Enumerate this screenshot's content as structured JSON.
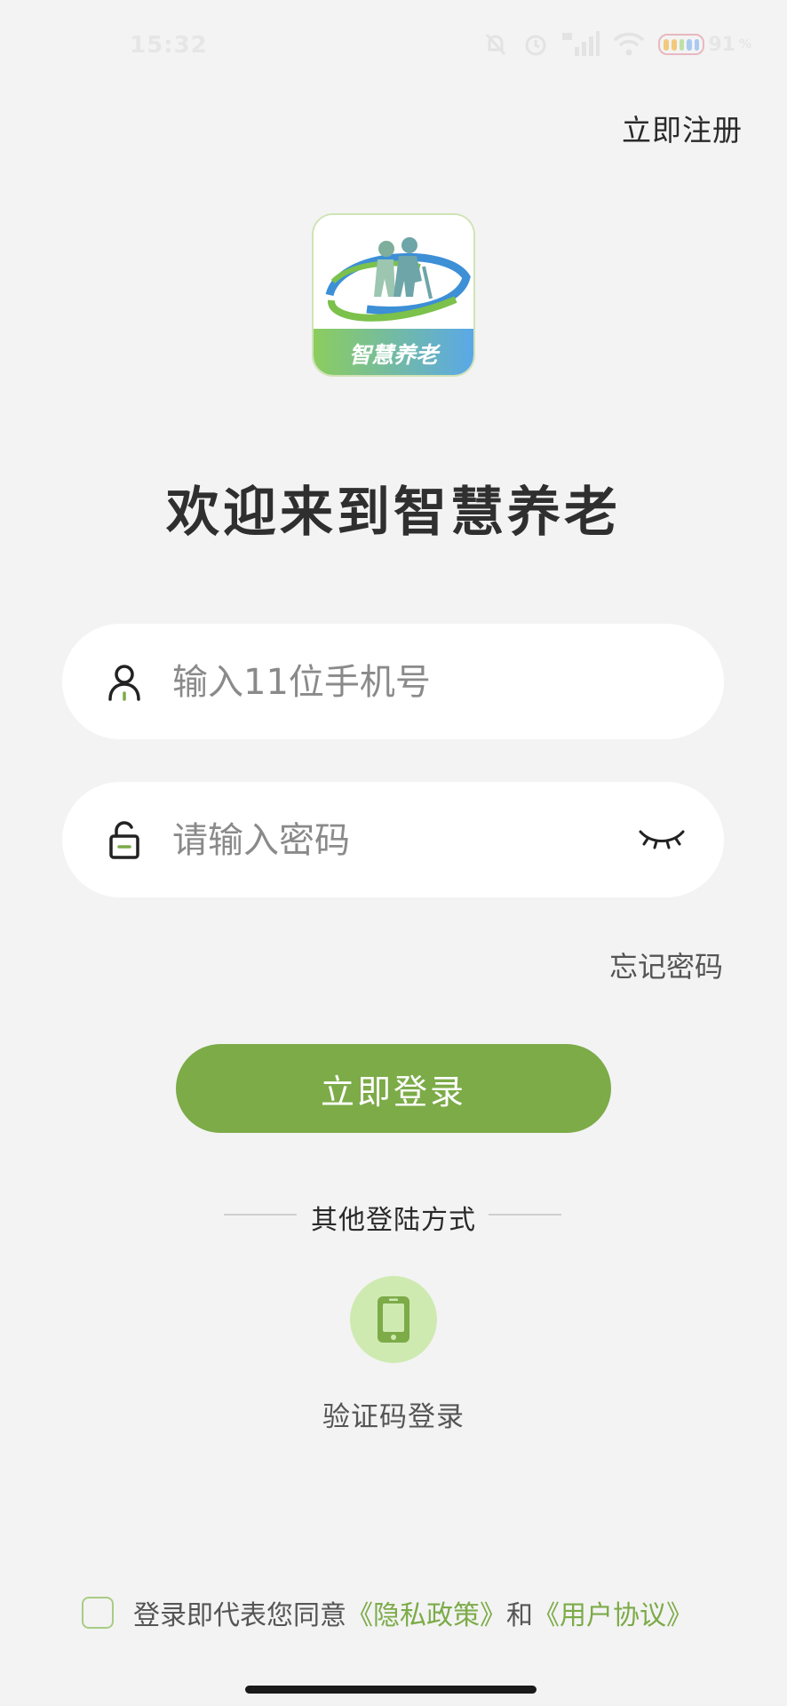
{
  "status_bar": {
    "time": "15:32",
    "battery_percent": "91"
  },
  "header": {
    "register_label": "立即注册"
  },
  "logo": {
    "text": "智慧养老"
  },
  "welcome_title": "欢迎来到智慧养老",
  "phone_field": {
    "placeholder": "输入11位手机号",
    "value": ""
  },
  "password_field": {
    "placeholder": "请输入密码",
    "value": ""
  },
  "forgot_password_label": "忘记密码",
  "login_button_label": "立即登录",
  "other_methods_label": "其他登陆方式",
  "sms_login_label": "验证码登录",
  "agreement": {
    "prefix": "登录即代表您同意",
    "privacy_link": "《隐私政策》",
    "and": "和",
    "terms_link": "《用户协议》",
    "checked": false
  },
  "colors": {
    "accent": "#7cab48",
    "accent_light": "#cfeab1",
    "background": "#f3f3f3"
  }
}
